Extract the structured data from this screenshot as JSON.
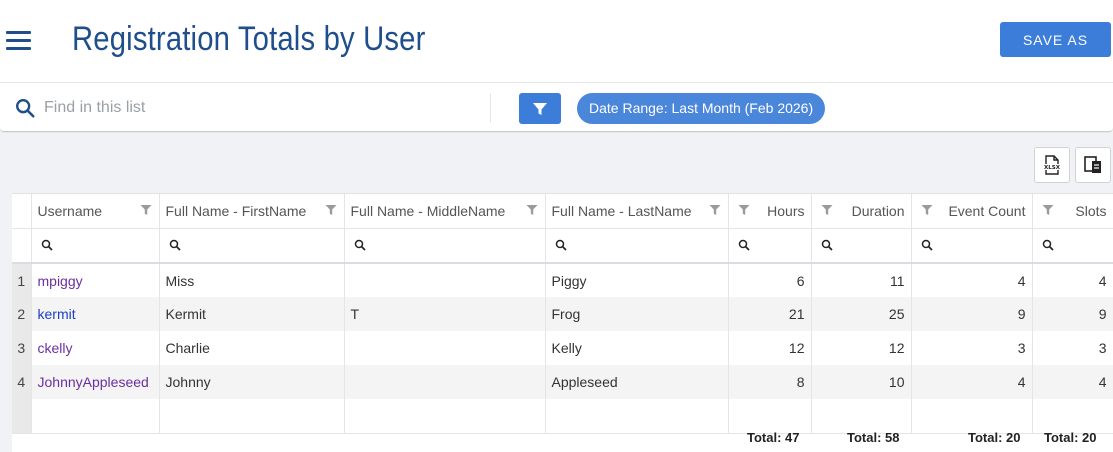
{
  "header": {
    "title": "Registration Totals by User",
    "save_label": "SAVE AS"
  },
  "search": {
    "placeholder": "Find in this list",
    "value": ""
  },
  "filter_chip": "Date Range: Last Month (Feb 2026)",
  "toolbar": {
    "export_icon": "xlsx-export-icon",
    "columns_icon": "column-chooser-icon"
  },
  "colors": {
    "accent": "#3b7dd8",
    "title": "#1f4e8c",
    "link_visited": "#6b2fa0",
    "link_active": "#1a3fc4"
  },
  "table": {
    "columns": [
      "Username",
      "Full Name - FirstName",
      "Full Name - MiddleName",
      "Full Name - LastName",
      "Hours",
      "Duration",
      "Event Count",
      "Slots"
    ],
    "rows": [
      {
        "num": "1",
        "username": "mpiggy",
        "first": "Miss",
        "middle": "",
        "last": "Piggy",
        "hours": "6",
        "duration": "11",
        "events": "4",
        "slots": "4"
      },
      {
        "num": "2",
        "username": "kermit",
        "first": "Kermit",
        "middle": "T",
        "last": "Frog",
        "hours": "21",
        "duration": "25",
        "events": "9",
        "slots": "9"
      },
      {
        "num": "3",
        "username": "ckelly",
        "first": "Charlie",
        "middle": "",
        "last": "Kelly",
        "hours": "12",
        "duration": "12",
        "events": "3",
        "slots": "3"
      },
      {
        "num": "4",
        "username": "JohnnyAppleseed",
        "first": "Johnny",
        "middle": "",
        "last": "Appleseed",
        "hours": "8",
        "duration": "10",
        "events": "4",
        "slots": "4"
      }
    ],
    "totals": {
      "hours": "Total: 47",
      "duration": "Total: 58",
      "events": "Total: 20",
      "slots": "Total: 20"
    }
  }
}
